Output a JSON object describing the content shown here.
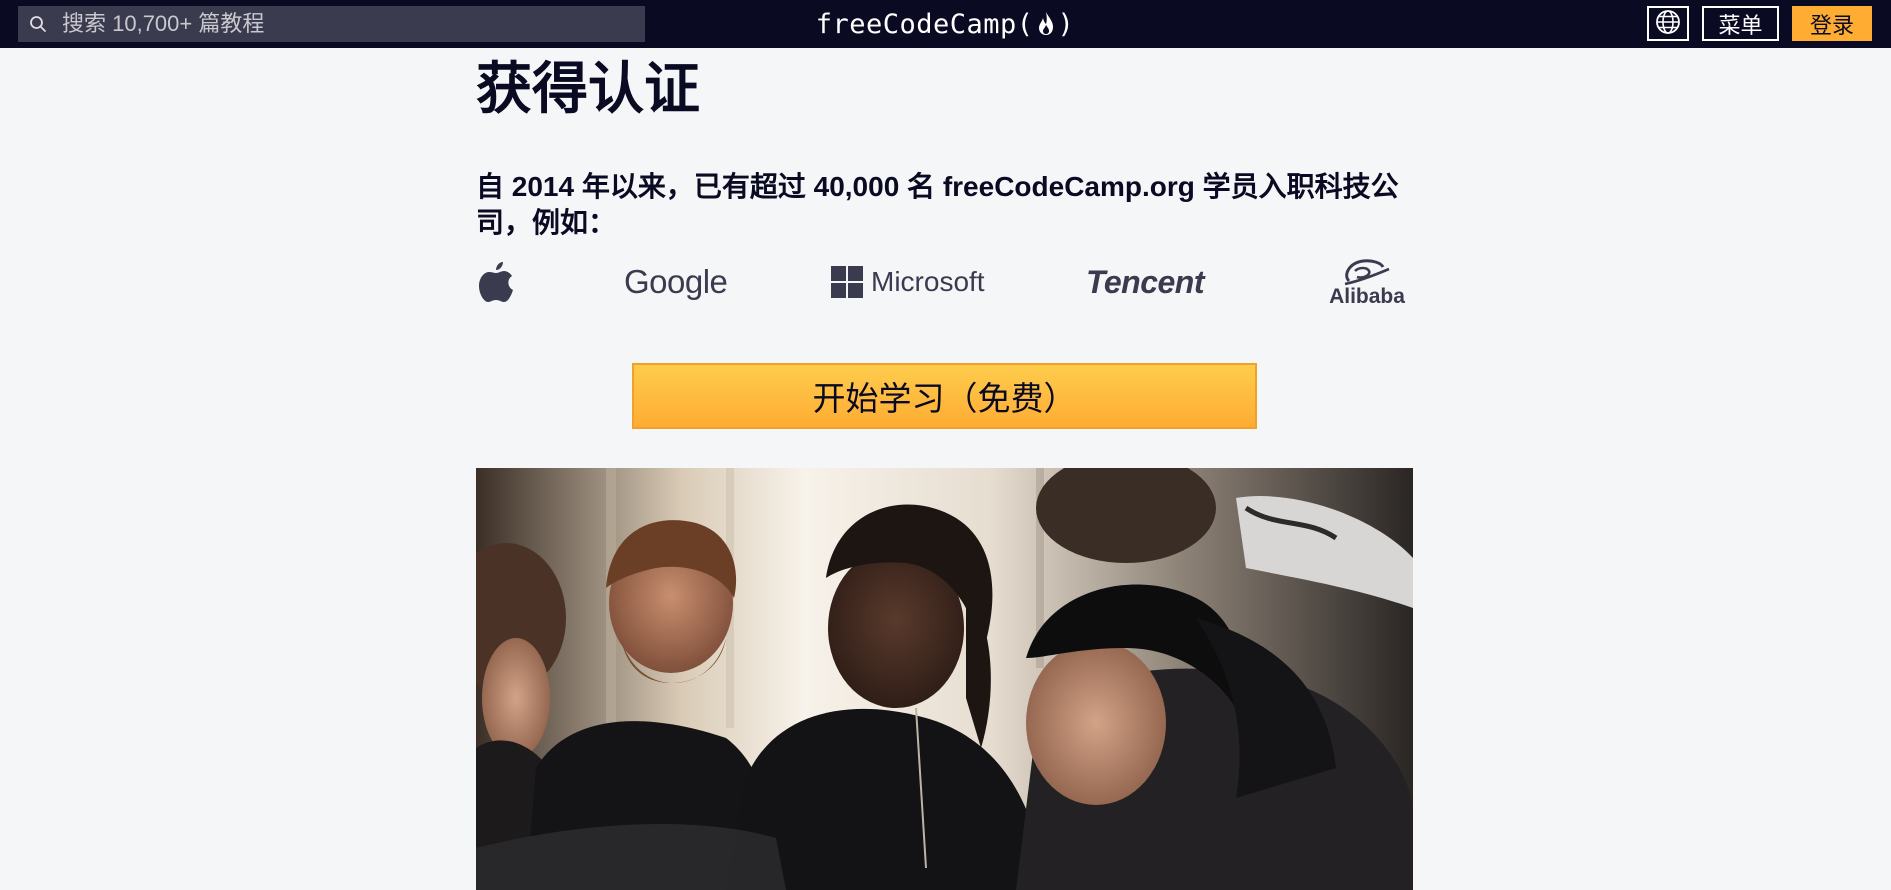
{
  "nav": {
    "search_placeholder": "搜索 10,700+ 篇教程",
    "brand_left": "freeCodeCamp(",
    "brand_right": ")",
    "menu_label": "菜单",
    "login_label": "登录",
    "icons": [
      "search-icon",
      "flame-icon",
      "globe-icon"
    ]
  },
  "main": {
    "title": "获得认证",
    "subtitle": "自 2014 年以来，已有超过 40,000 名 freeCodeCamp.org 学员入职科技公司，例如：",
    "companies": [
      "Google",
      "Microsoft",
      "Tencent",
      "Alibaba"
    ],
    "cta_label": "开始学习（免费）"
  },
  "colors": {
    "nav_bg": "#0a0a23",
    "accent": "#feac32",
    "page_bg": "#f5f6f7",
    "logo_gray": "#3b3b4f"
  }
}
